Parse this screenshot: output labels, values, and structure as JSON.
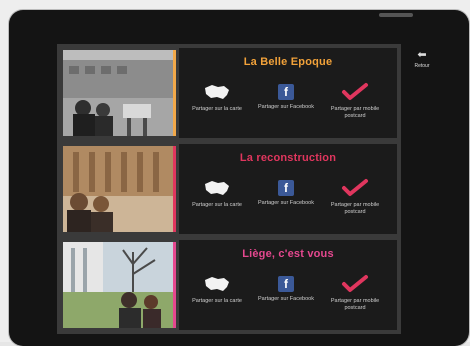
{
  "header": {
    "back_label": "Retour"
  },
  "rows": [
    {
      "title": "La Belle Epoque",
      "title_color": "#f2a23a",
      "actions": [
        {
          "label": "Partager sur la carte",
          "icon": "map-belgium-icon"
        },
        {
          "label": "Partager sur Facebook",
          "icon": "facebook-icon"
        },
        {
          "label": "Partager par mobile postcard",
          "icon": "postcard-check-icon"
        }
      ]
    },
    {
      "title": "La reconstruction",
      "title_color": "#e0365e",
      "actions": [
        {
          "label": "Partager sur la carte",
          "icon": "map-belgium-icon"
        },
        {
          "label": "Partager sur Facebook",
          "icon": "facebook-icon"
        },
        {
          "label": "Partager par mobile postcard",
          "icon": "postcard-check-icon"
        }
      ]
    },
    {
      "title": "Liège, c'est vous",
      "title_color": "#e5488f",
      "actions": [
        {
          "label": "Partager sur la carte",
          "icon": "map-belgium-icon"
        },
        {
          "label": "Partager sur Facebook",
          "icon": "facebook-icon"
        },
        {
          "label": "Partager par mobile postcard",
          "icon": "postcard-check-icon"
        }
      ]
    }
  ],
  "fb_glyph": "f",
  "colors": {
    "accent_orange": "#f2a94a",
    "accent_red": "#e0365e",
    "panel_bg": "#1b1b1b"
  }
}
